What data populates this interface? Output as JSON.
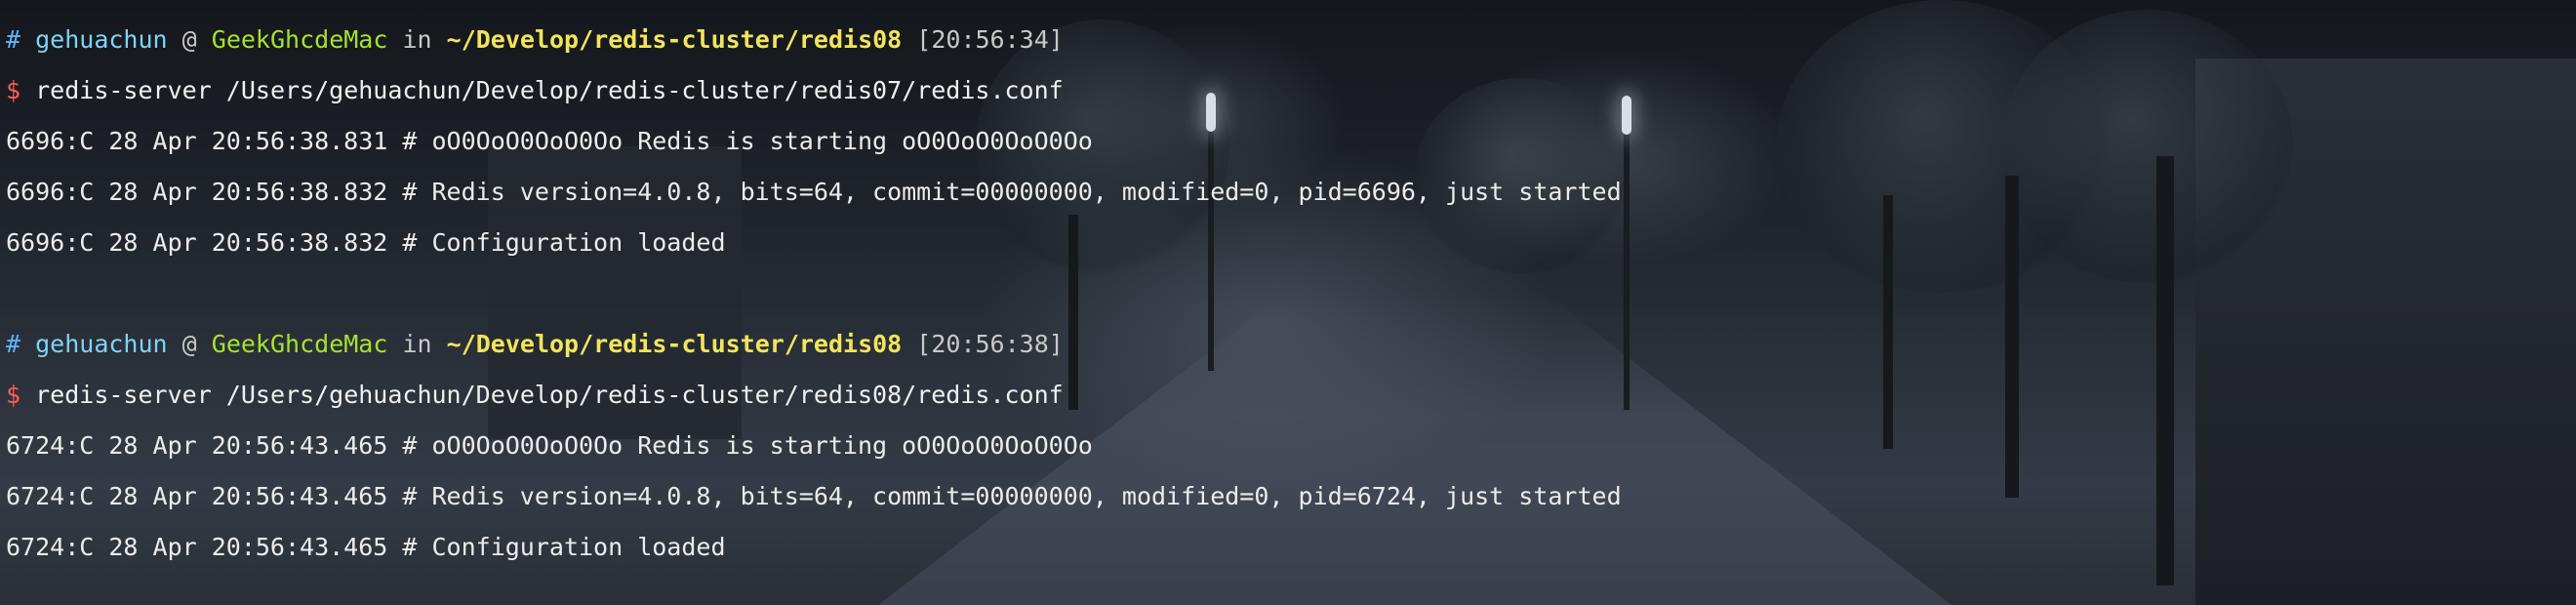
{
  "colors": {
    "hash": "#5fb3ff",
    "user": "#7fd3f5",
    "host": "#a6e22e",
    "path": "#f2e45c",
    "dollar": "#ff5f56",
    "text": "#ececec"
  },
  "blocks": [
    {
      "prompt": {
        "hash": "#",
        "user": "gehuachun",
        "at": "@",
        "host": "GeekGhcdeMac",
        "in": "in",
        "path": "~/Develop/redis-cluster/redis08",
        "time": "[20:56:34]"
      },
      "command": {
        "dollar": "$",
        "text": "redis-server /Users/gehuachun/Develop/redis-cluster/redis07/redis.conf"
      },
      "output": [
        "6696:C 28 Apr 20:56:38.831 # oO0OoO0OoO0Oo Redis is starting oO0OoO0OoO0Oo",
        "6696:C 28 Apr 20:56:38.832 # Redis version=4.0.8, bits=64, commit=00000000, modified=0, pid=6696, just started",
        "6696:C 28 Apr 20:56:38.832 # Configuration loaded"
      ]
    },
    {
      "prompt": {
        "hash": "#",
        "user": "gehuachun",
        "at": "@",
        "host": "GeekGhcdeMac",
        "in": "in",
        "path": "~/Develop/redis-cluster/redis08",
        "time": "[20:56:38]"
      },
      "command": {
        "dollar": "$",
        "text": "redis-server /Users/gehuachun/Develop/redis-cluster/redis08/redis.conf"
      },
      "output": [
        "6724:C 28 Apr 20:56:43.465 # oO0OoO0OoO0Oo Redis is starting oO0OoO0OoO0Oo",
        "6724:C 28 Apr 20:56:43.465 # Redis version=4.0.8, bits=64, commit=00000000, modified=0, pid=6724, just started",
        "6724:C 28 Apr 20:56:43.465 # Configuration loaded"
      ]
    }
  ]
}
